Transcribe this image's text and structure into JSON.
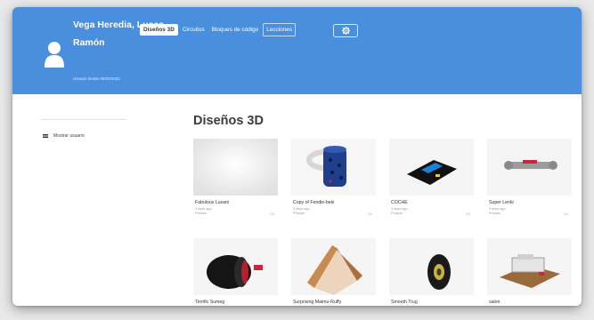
{
  "header": {
    "user_name": "Vega Heredia, Lucas Ramón",
    "user_since": "Usuario desde 09/03/2022",
    "tabs": [
      {
        "label": "Diseños 3D",
        "active": true
      },
      {
        "label": "Circuitos",
        "active": false
      },
      {
        "label": "Bloques de código",
        "active": false
      },
      {
        "label": "Lecciones",
        "active": false
      }
    ],
    "settings_icon": "gear-icon",
    "accent": "#4a8fde"
  },
  "sidebar": {
    "items": [
      {
        "label": "Mostrar usuario",
        "icon": "menu-icon"
      }
    ]
  },
  "main": {
    "title": "Diseños 3D",
    "designs": [
      {
        "title": "Fabulous Lusam",
        "age": "3 days ago",
        "privacy": "Privado",
        "count": "2/4"
      },
      {
        "title": "Copy of Fendie-beki",
        "age": "3 days ago",
        "privacy": "Privado",
        "count": "2/4"
      },
      {
        "title": "COCHE",
        "age": "3 days ago",
        "privacy": "Privado",
        "count": "2/3"
      },
      {
        "title": "Super Lenki",
        "age": "3 days ago",
        "privacy": "Privado",
        "count": "2/4"
      },
      {
        "title": "Terrific Sumeg",
        "age": "",
        "privacy": "",
        "count": ""
      },
      {
        "title": "Surprising Maimu-Ruffy",
        "age": "",
        "privacy": "",
        "count": ""
      },
      {
        "title": "Smooth Trug",
        "age": "",
        "privacy": "",
        "count": ""
      },
      {
        "title": "salon",
        "age": "",
        "privacy": "",
        "count": ""
      }
    ]
  }
}
